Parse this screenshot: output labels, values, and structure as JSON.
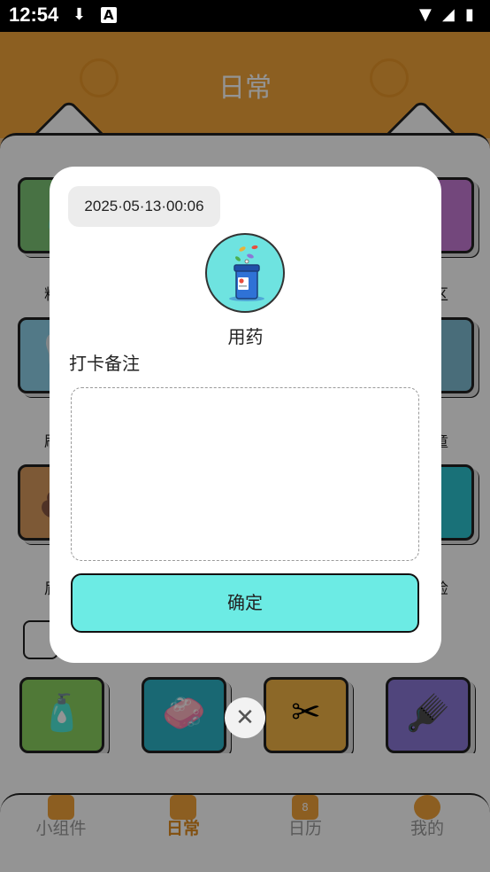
{
  "status_bar": {
    "time": "12:54",
    "left_icons": [
      "download-icon",
      "font-icon"
    ],
    "right_icons": [
      "wifi-icon",
      "signal-icon",
      "battery-icon"
    ]
  },
  "header": {
    "title": "日常"
  },
  "background_tiles": {
    "row1": [
      {
        "label": "料",
        "color": "#7cc576"
      },
      {
        "label": "区",
        "color": "#c77ad6"
      }
    ],
    "row2": [
      {
        "label": "刷",
        "color": "#8ed0e8"
      },
      {
        "label": "童",
        "color": "#7fbcd2"
      }
    ],
    "row3": [
      {
        "label": "屁",
        "color": "#d89a5d"
      },
      {
        "label": "检",
        "color": "#2bc3cf"
      }
    ],
    "row4": [
      {
        "icon": "sanitizer-icon",
        "color": "#8bd05f"
      },
      {
        "icon": "soap-icon",
        "color": "#2cb4c6"
      },
      {
        "icon": "scissors-icon",
        "color": "#f2b445"
      },
      {
        "icon": "brush-icon",
        "color": "#8b78d6"
      }
    ]
  },
  "tab_bar": {
    "tabs": [
      {
        "label": "小组件",
        "icon": "widget-icon",
        "active": false
      },
      {
        "label": "日常",
        "icon": "daily-icon",
        "active": true
      },
      {
        "label": "日历",
        "icon": "calendar-icon",
        "active": false,
        "badge": "8"
      },
      {
        "label": "我的",
        "icon": "profile-icon",
        "active": false
      }
    ]
  },
  "dialog": {
    "date": "2025·05·13·00:06",
    "activity_icon": "medicine-bottle-icon",
    "activity_name": "用药",
    "note_label": "打卡备注",
    "note_value": "",
    "note_placeholder": "",
    "confirm_label": "确定",
    "close_icon": "close-icon"
  },
  "colors": {
    "accent": "#6cebe4",
    "header": "#f1a43a",
    "overlay": "rgba(0,0,0,0.42)"
  }
}
